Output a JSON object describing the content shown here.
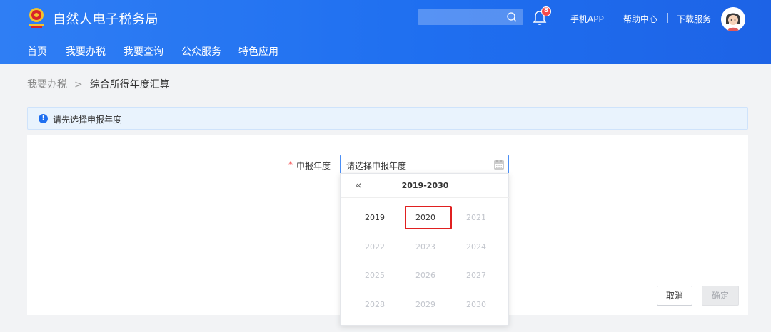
{
  "header": {
    "title": "自然人电子税务局",
    "search_placeholder": "",
    "notification_count": "8",
    "links": [
      "手机APP",
      "帮助中心",
      "下载服务"
    ]
  },
  "nav": [
    "首页",
    "我要办税",
    "我要查询",
    "公众服务",
    "特色应用"
  ],
  "breadcrumb": {
    "parent": "我要办税",
    "separator": ">",
    "current": "综合所得年度汇算"
  },
  "notice": {
    "icon": "!",
    "text": "请先选择申报年度"
  },
  "form": {
    "required_mark": "*",
    "label": "申报年度",
    "placeholder": "请选择申报年度"
  },
  "year_picker": {
    "prev_icon": "«",
    "range": "2019-2030",
    "years": [
      {
        "label": "2019",
        "enabled": true
      },
      {
        "label": "2020",
        "enabled": true,
        "highlighted": true
      },
      {
        "label": "2021",
        "enabled": false
      },
      {
        "label": "2022",
        "enabled": false
      },
      {
        "label": "2023",
        "enabled": false
      },
      {
        "label": "2024",
        "enabled": false
      },
      {
        "label": "2025",
        "enabled": false
      },
      {
        "label": "2026",
        "enabled": false
      },
      {
        "label": "2027",
        "enabled": false
      },
      {
        "label": "2028",
        "enabled": false
      },
      {
        "label": "2029",
        "enabled": false
      },
      {
        "label": "2030",
        "enabled": false
      }
    ]
  },
  "buttons": {
    "cancel": "取消",
    "confirm": "确定"
  },
  "colors": {
    "header_blue": "#1f6ff0",
    "highlight_red": "#e02020",
    "badge_red": "#f5484b"
  }
}
